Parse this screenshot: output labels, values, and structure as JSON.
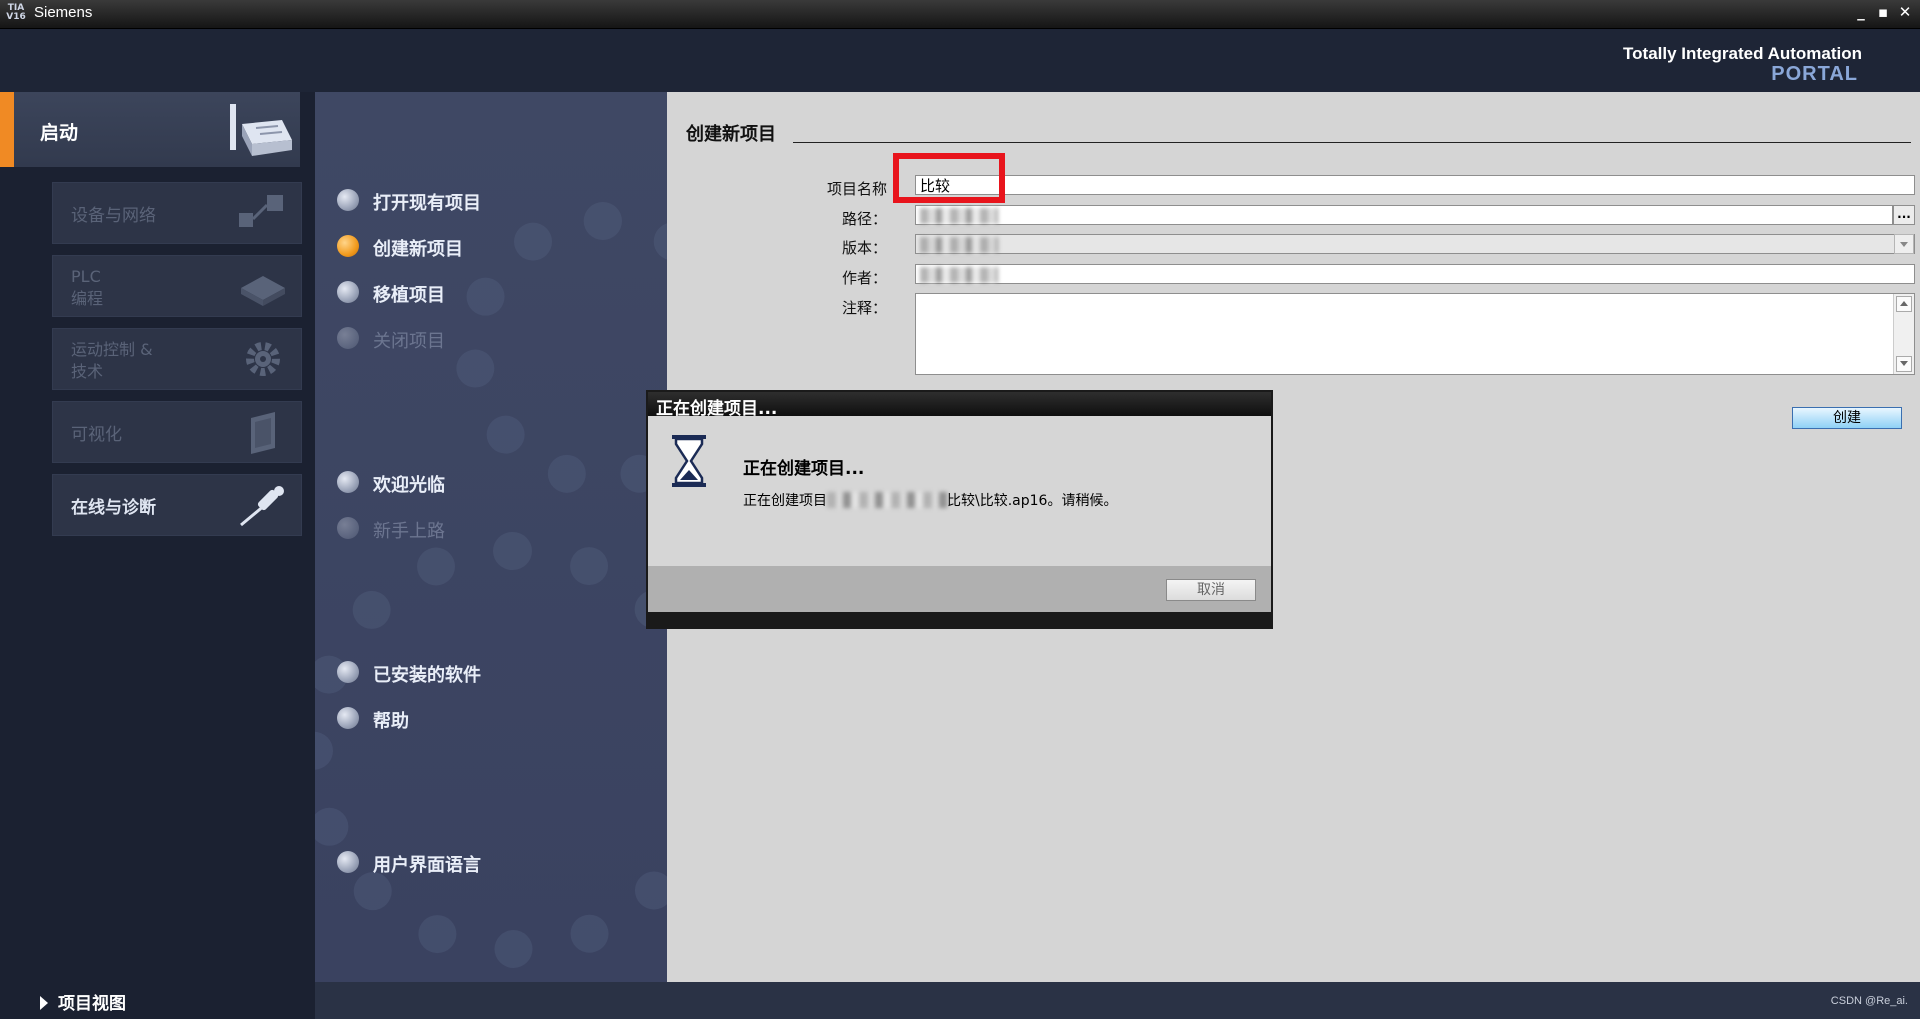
{
  "window": {
    "logo_text": "TIA V16",
    "title": "Siemens",
    "buttons": {
      "minimize": "_",
      "restore": "▪",
      "close": "✕"
    }
  },
  "brand": {
    "line1": "Totally Integrated Automation",
    "line2": "PORTAL",
    "accent_color": "#8aa7d8"
  },
  "left_nav": {
    "start_label": "启动",
    "accent_color": "#f08a24",
    "tiles": [
      {
        "label": "设备与网络",
        "icon": "devices-network-icon",
        "enabled": false
      },
      {
        "label_line1": "PLC",
        "label_line2": "编程",
        "icon": "plc-programming-icon",
        "enabled": false
      },
      {
        "label_line1": "运动控制 &",
        "label_line2": "技术",
        "icon": "gear-icon",
        "enabled": false
      },
      {
        "label": "可视化",
        "icon": "visualization-icon",
        "enabled": false
      },
      {
        "label": "在线与诊断",
        "icon": "screwdriver-icon",
        "enabled": true
      }
    ],
    "project_view": "项目视图"
  },
  "actions": [
    {
      "label": "打开现有项目",
      "state": "normal"
    },
    {
      "label": "创建新项目",
      "state": "selected"
    },
    {
      "label": "移植项目",
      "state": "normal"
    },
    {
      "label": "关闭项目",
      "state": "disabled"
    },
    {
      "label": "欢迎光临",
      "state": "normal"
    },
    {
      "label": "新手上路",
      "state": "disabled"
    },
    {
      "label": "已安装的软件",
      "state": "normal"
    },
    {
      "label": "帮助",
      "state": "normal"
    },
    {
      "label": "用户界面语言",
      "state": "normal"
    }
  ],
  "form": {
    "section_title": "创建新项目",
    "fields": {
      "project_name": {
        "label": "项目名称",
        "value": "比较"
      },
      "path": {
        "label": "路径：",
        "value": ""
      },
      "version": {
        "label": "版本：",
        "value": ""
      },
      "author": {
        "label": "作者：",
        "value": ""
      },
      "comment": {
        "label": "注释：",
        "value": ""
      }
    },
    "browse_label": "...",
    "create_button": "创建",
    "highlight_color": "#e8141c"
  },
  "dialog": {
    "title": "正在创建项目...",
    "heading": "正在创建项目...",
    "message_prefix": "正在创建项目",
    "message_suffix": "比较\\比较.ap16。请稍候。",
    "cancel_button": "取消"
  },
  "status": {
    "watermark": "CSDN @Re_ai."
  }
}
